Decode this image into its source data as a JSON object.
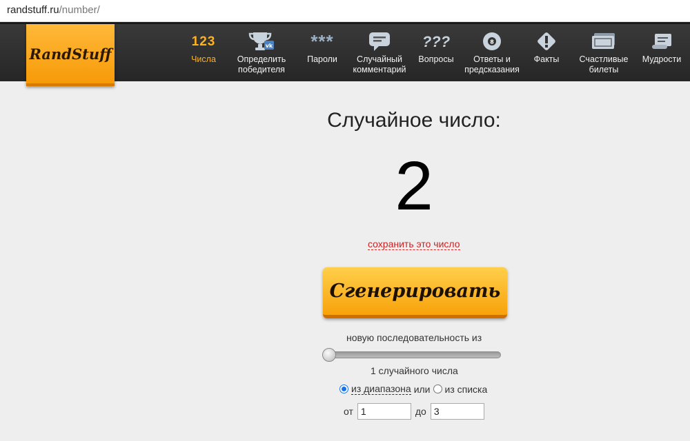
{
  "browser": {
    "host": "randstuff.ru",
    "path": "/number/"
  },
  "logo": {
    "text": "RandStuff"
  },
  "nav": {
    "items": [
      {
        "label": "Числа",
        "icon": "numbers-icon",
        "icon_text": "123",
        "active": true
      },
      {
        "label": "Определить победителя",
        "icon": "trophy-icon"
      },
      {
        "label": "Пароли",
        "icon": "password-icon",
        "icon_text": "***"
      },
      {
        "label": "Случайный комментарий",
        "icon": "comment-icon"
      },
      {
        "label": "Вопросы",
        "icon": "question-icon",
        "icon_text": "???"
      },
      {
        "label": "Ответы и предсказания",
        "icon": "magic-ball-icon"
      },
      {
        "label": "Факты",
        "icon": "exclamation-icon"
      },
      {
        "label": "Счастливые билеты",
        "icon": "ticket-icon"
      },
      {
        "label": "Мудрости",
        "icon": "scroll-icon"
      }
    ]
  },
  "main": {
    "title": "Случайное число:",
    "number": "2",
    "save_link": "сохранить это число",
    "generate_button": "Сгенерировать",
    "sequence_label": "новую последовательность из",
    "count_label": "1 случайного числа",
    "slider_value": 1,
    "mode": {
      "range_label": "из диапазона",
      "or": "или",
      "list_label": "из списка",
      "selected": "range"
    },
    "range": {
      "from_label": "от",
      "from_value": "1",
      "to_label": "до",
      "to_value": "3"
    }
  },
  "colors": {
    "accent": "#ffb21e",
    "link": "#cc2222",
    "header_bg": "#2e2e2e"
  }
}
